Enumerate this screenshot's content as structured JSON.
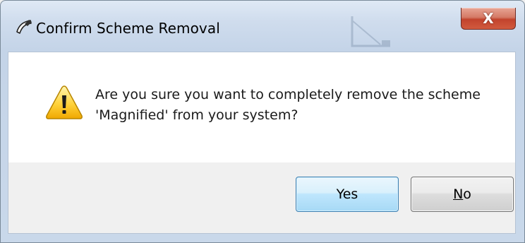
{
  "dialog": {
    "title": "Confirm Scheme Removal",
    "close_label": "X",
    "message_line1": "Are you sure you want to completely remove the scheme",
    "message_line2": "'Magnified' from your system?",
    "icons": {
      "title_icon": "pointer-cursor-icon",
      "message_icon": "warning-icon"
    }
  },
  "buttons": {
    "yes_label": "Yes",
    "no_access_key": "N",
    "no_rest": "o"
  },
  "colors": {
    "accent_default_button": "#3c7fb1",
    "close_button": "#c2432d",
    "content_background": "#ffffff",
    "footer_background": "#f0f0f0"
  }
}
